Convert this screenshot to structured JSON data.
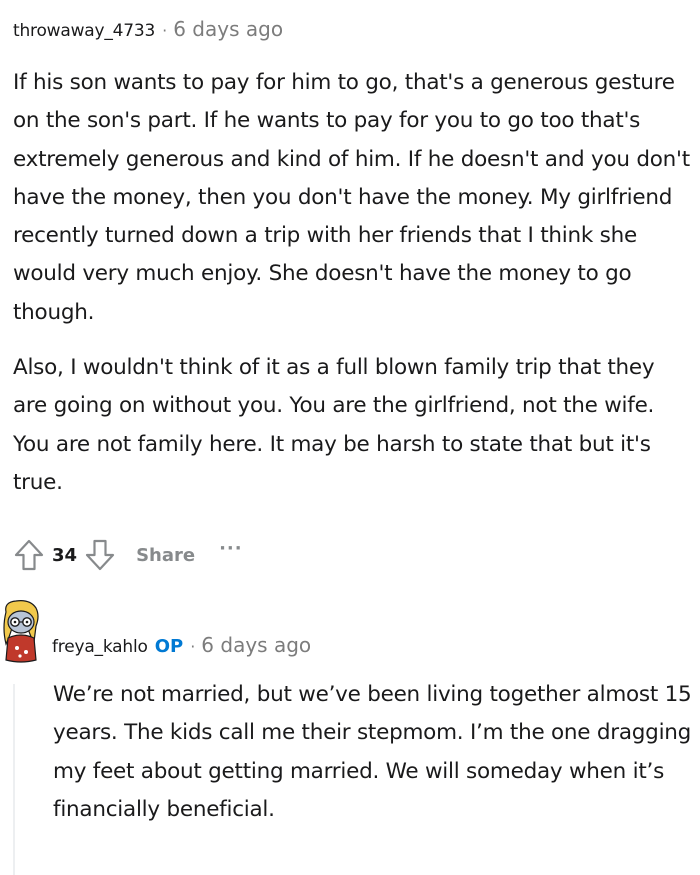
{
  "comment": {
    "username": "throwaway_4733",
    "separator": "·",
    "timestamp": "6 days ago",
    "paragraphs": [
      "If his son wants to pay for him to go, that's a generous gesture on the son's part. If he wants to pay for you to go too that's extremely generous and kind of him. If he doesn't and you don't have the money, then you don't have the money. My girlfriend recently turned down a trip with her friends that I think she would very much enjoy. She doesn't have the money to go though.",
      "Also, I wouldn't think of it as a full blown family trip that they are going on without you. You are the girlfriend, not the wife. You are not family here. It may be harsh to state that but it's true."
    ],
    "actions": {
      "upvote_icon": "upvote-arrow",
      "score": "34",
      "downvote_icon": "downvote-arrow",
      "share_label": "Share",
      "more_label": "···"
    }
  },
  "reply": {
    "avatar_icon": "snoo-avatar",
    "username": "freya_kahlo",
    "op_badge": "OP",
    "separator": "·",
    "timestamp": "6 days ago",
    "paragraphs": [
      "We’re not married, but we’ve been living together almost 15 years. The kids call me their stepmom. I’m the one dragging my feet about getting married. We will someday when it’s financially beneficial."
    ]
  },
  "colors": {
    "text": "#1a1a1b",
    "meta": "#7c7c7c",
    "action_gray": "#878a8c",
    "op_blue": "#0079d3",
    "thread_line": "#edeff1"
  }
}
